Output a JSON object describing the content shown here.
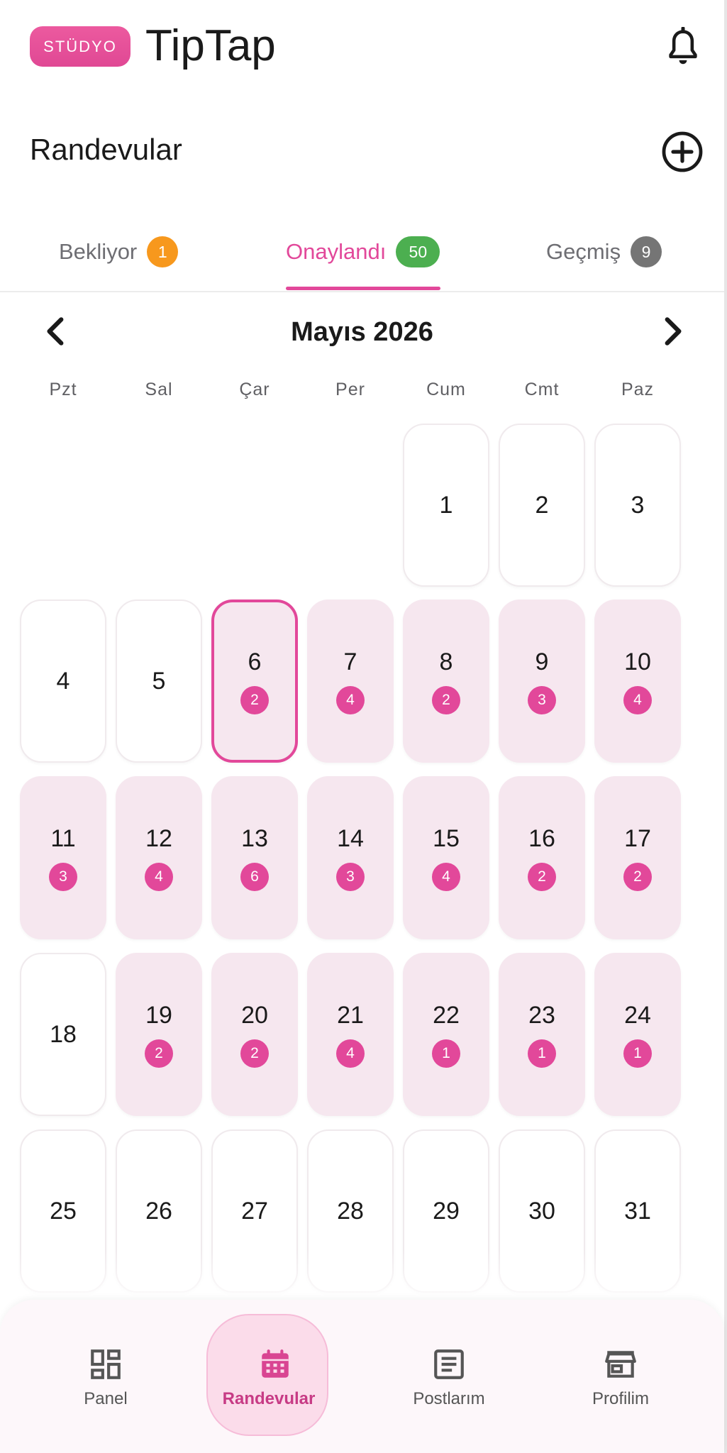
{
  "header": {
    "badge": "STÜDYO",
    "app_name": "TipTap"
  },
  "section": {
    "title": "Randevular"
  },
  "tabs": [
    {
      "label": "Bekliyor",
      "count": "1",
      "color": "#f7981d"
    },
    {
      "label": "Onaylandı",
      "count": "50",
      "color": "#4caf50"
    },
    {
      "label": "Geçmiş",
      "count": "9",
      "color": "#757575"
    }
  ],
  "calendar": {
    "month_title": "Mayıs 2026",
    "weekdays": [
      "Pzt",
      "Sal",
      "Çar",
      "Per",
      "Cum",
      "Cmt",
      "Paz"
    ],
    "selected_day": "6",
    "days": [
      {
        "day": "1",
        "count": ""
      },
      {
        "day": "2",
        "count": ""
      },
      {
        "day": "3",
        "count": ""
      },
      {
        "day": "4",
        "count": ""
      },
      {
        "day": "5",
        "count": ""
      },
      {
        "day": "6",
        "count": "2"
      },
      {
        "day": "7",
        "count": "4"
      },
      {
        "day": "8",
        "count": "2"
      },
      {
        "day": "9",
        "count": "3"
      },
      {
        "day": "10",
        "count": "4"
      },
      {
        "day": "11",
        "count": "3"
      },
      {
        "day": "12",
        "count": "4"
      },
      {
        "day": "13",
        "count": "6"
      },
      {
        "day": "14",
        "count": "3"
      },
      {
        "day": "15",
        "count": "4"
      },
      {
        "day": "16",
        "count": "2"
      },
      {
        "day": "17",
        "count": "2"
      },
      {
        "day": "18",
        "count": ""
      },
      {
        "day": "19",
        "count": "2"
      },
      {
        "day": "20",
        "count": "2"
      },
      {
        "day": "21",
        "count": "4"
      },
      {
        "day": "22",
        "count": "1"
      },
      {
        "day": "23",
        "count": "1"
      },
      {
        "day": "24",
        "count": "1"
      },
      {
        "day": "25",
        "count": ""
      },
      {
        "day": "26",
        "count": ""
      },
      {
        "day": "27",
        "count": ""
      },
      {
        "day": "28",
        "count": ""
      },
      {
        "day": "29",
        "count": ""
      },
      {
        "day": "30",
        "count": ""
      },
      {
        "day": "31",
        "count": ""
      }
    ]
  },
  "bottom_nav": [
    {
      "label": "Panel",
      "icon": "dashboard-icon"
    },
    {
      "label": "Randevular",
      "icon": "calendar-icon",
      "active": true
    },
    {
      "label": "Postlarım",
      "icon": "article-icon"
    },
    {
      "label": "Profilim",
      "icon": "storefront-icon"
    }
  ],
  "colors": {
    "accent": "#e2489a",
    "cell_highlight": "#f6e7ef"
  }
}
